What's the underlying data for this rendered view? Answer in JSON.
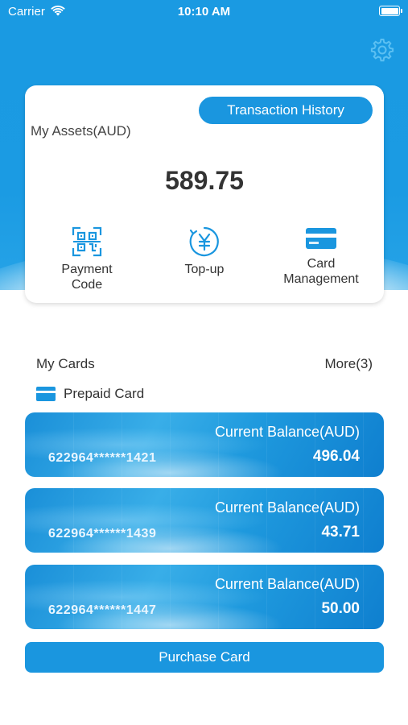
{
  "status_bar": {
    "carrier": "Carrier",
    "time": "10:10 AM"
  },
  "assets": {
    "transaction_history_label": "Transaction History",
    "label": "My Assets(AUD)",
    "amount": "589.75"
  },
  "actions": {
    "payment_code": {
      "line1": "Payment",
      "line2": "Code"
    },
    "topup": {
      "label": "Top-up"
    },
    "card_management": {
      "line1": "Card",
      "line2": "Management"
    }
  },
  "my_cards": {
    "label": "My Cards",
    "more": "More(3)",
    "category": "Prepaid Card"
  },
  "cards": [
    {
      "title": "Current Balance(AUD)",
      "number": "622964******1421",
      "balance": "496.04"
    },
    {
      "title": "Current Balance(AUD)",
      "number": "622964******1439",
      "balance": "43.71"
    },
    {
      "title": "Current Balance(AUD)",
      "number": "622964******1447",
      "balance": "50.00"
    }
  ],
  "purchase_label": "Purchase Card",
  "colors": {
    "primary": "#1a96df",
    "hero": "#1b9be3",
    "text": "#333333"
  },
  "icons": [
    "wifi-icon",
    "battery-icon",
    "gear-icon",
    "qr-code-icon",
    "yen-coin-icon",
    "card-icon"
  ]
}
